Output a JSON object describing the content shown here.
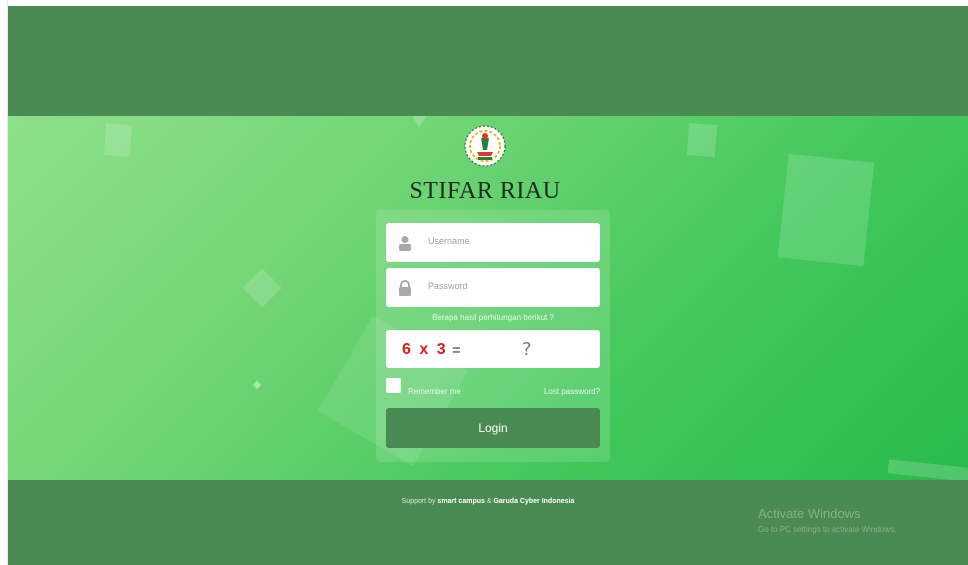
{
  "brand": {
    "name": "STIFAR RIAU"
  },
  "login_form": {
    "username_placeholder": "Username",
    "password_placeholder": "Password",
    "calc_label": "Berapa hasil perhitungan berikut ?",
    "captcha_expression": "6 x 3",
    "captcha_equals": "=",
    "captcha_answer_placeholder": "?",
    "remember_label": "Remember me",
    "lost_password_label": "Lost password?",
    "login_label": "Login"
  },
  "footer": {
    "support_prefix": "Support by",
    "partner1": "smart campus",
    "connector": "&",
    "partner2": "Garuda Cyber Indonesia"
  },
  "windows_watermark": {
    "title": "Activate Windows",
    "subtitle": "Go to PC settings to activate Windows."
  },
  "colors": {
    "header_footer": "#4b8a52",
    "hero_light": "#8ee08a",
    "hero_dark": "#29b94c",
    "captcha_text": "#d71f1f",
    "login_button": "#4b8a52"
  },
  "icons": [
    "user-icon",
    "lock-icon",
    "school-logo"
  ]
}
